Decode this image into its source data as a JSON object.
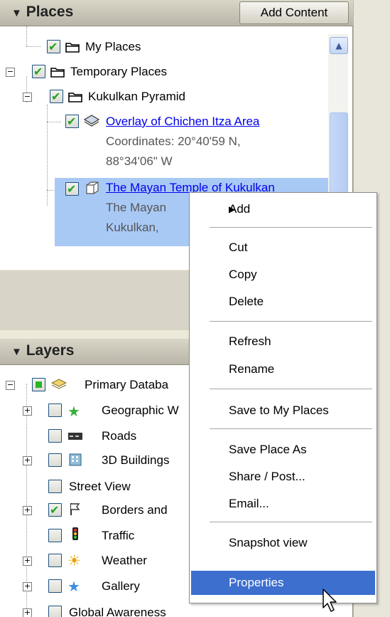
{
  "places": {
    "title": "Places",
    "add_content_label": "Add Content",
    "items": [
      {
        "label": "My Places"
      },
      {
        "label": "Temporary Places"
      },
      {
        "label": "Kukulkan Pyramid"
      },
      {
        "label": "Overlay of Chichen Itza Area",
        "sub1": "Coordinates: 20°40'59 N,",
        "sub2": "88°34'06\" W"
      },
      {
        "label": "The Mayan Temple of Kukulkan",
        "sub1": "The Mayan",
        "sub2": "Kukulkan,"
      }
    ]
  },
  "layers": {
    "title": "Layers",
    "items": [
      {
        "label": "Primary Databa"
      },
      {
        "label": "Geographic W"
      },
      {
        "label": "Roads"
      },
      {
        "label": "3D Buildings"
      },
      {
        "label": "Street View"
      },
      {
        "label": "Borders and"
      },
      {
        "label": "Traffic"
      },
      {
        "label": "Weather"
      },
      {
        "label": "Gallery"
      },
      {
        "label": "Global Awareness"
      }
    ]
  },
  "context_menu": {
    "items": [
      {
        "label": "Add"
      },
      {
        "label": "Cut"
      },
      {
        "label": "Copy"
      },
      {
        "label": "Delete"
      },
      {
        "label": "Refresh"
      },
      {
        "label": "Rename"
      },
      {
        "label": "Save to My Places"
      },
      {
        "label": "Save Place As"
      },
      {
        "label": "Share / Post..."
      },
      {
        "label": "Email..."
      },
      {
        "label": "Snapshot view"
      },
      {
        "label": "Properties"
      }
    ],
    "highlighted": "Properties",
    "highlight_color": "#3d6fcf"
  },
  "colors": {
    "selection": "#a9c9f5",
    "link": "#0000ee"
  }
}
